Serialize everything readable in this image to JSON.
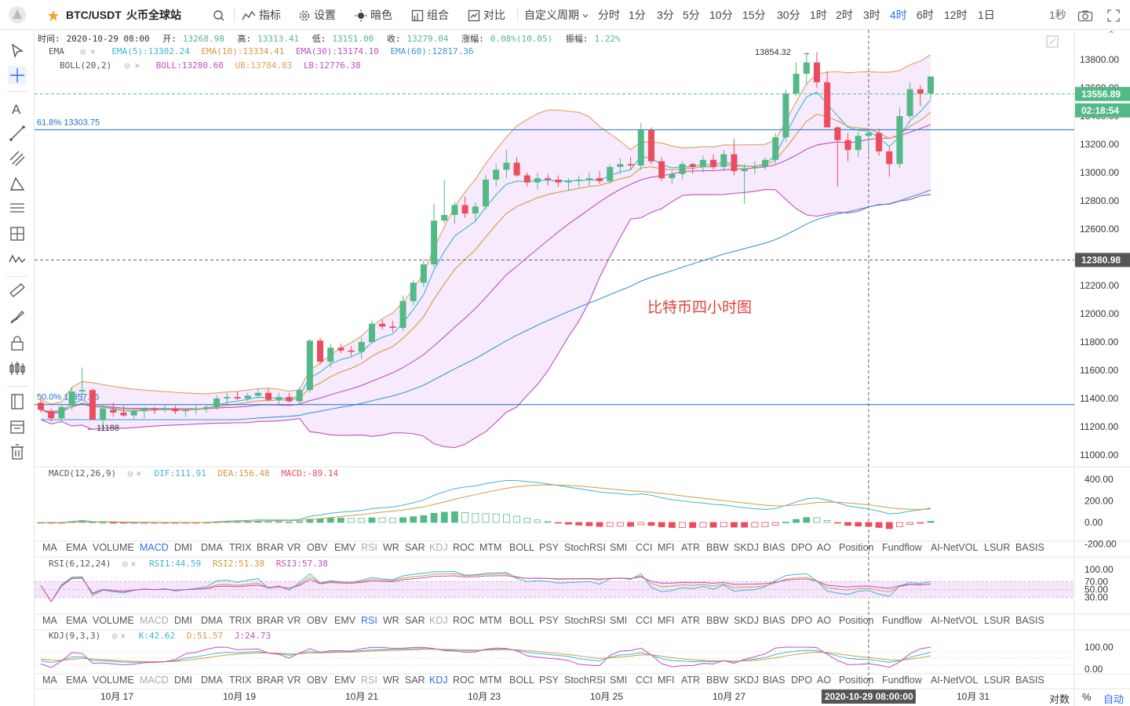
{
  "toolbar": {
    "symbol": "BTC/USDT",
    "exchange": "火币全球站",
    "indicators_label": "指标",
    "settings_label": "设置",
    "theme_label": "暗色",
    "combine_label": "组合",
    "compare_label": "对比",
    "custom_period_label": "自定义周期",
    "intervals": [
      "分时",
      "1分",
      "3分",
      "5分",
      "10分",
      "15分",
      "30分",
      "1时",
      "2时",
      "3时",
      "4时",
      "6时",
      "12时",
      "1日"
    ],
    "active_interval": "4时",
    "refresh_label": "1秒"
  },
  "ohlc_bar": {
    "time_label": "时间:",
    "time": "2020-10-29 08:00",
    "open_label": "开:",
    "open": "13268.98",
    "high_label": "高:",
    "high": "13313.41",
    "low_label": "低:",
    "low": "13151.00",
    "close_label": "收:",
    "close": "13279.04",
    "change_label": "涨幅:",
    "change": "0.08%(10.05)",
    "amplitude_label": "振幅:",
    "amplitude": "1.22%"
  },
  "ema_legend": {
    "name": "EMA",
    "ema5": "EMA(5):13302.24",
    "ema10": "EMA(10):13334.41",
    "ema30": "EMA(30):13174.10",
    "ema60": "EMA(60):12817.36"
  },
  "boll_legend": {
    "name": "BOLL(20,2)",
    "boll": "BOLL:13280.60",
    "ub": "UB:13784.83",
    "lb": "LB:12776.38"
  },
  "macd_legend": {
    "name": "MACD(12,26,9)",
    "dif": "DIF:111.91",
    "dea": "DEA:156.48",
    "macd": "MACD:-89.14"
  },
  "rsi_legend": {
    "name": "RSI(6,12,24)",
    "rsi1": "RSI1:44.59",
    "rsi2": "RSI2:51.38",
    "rsi3": "RSI3:57.38"
  },
  "kdj_legend": {
    "name": "KDJ(9,3,3)",
    "k": "K:42.62",
    "d": "D:51.57",
    "j": "J:24.73"
  },
  "indicator_tabs": [
    "MA",
    "EMA",
    "VOLUME",
    "MACD",
    "DMI",
    "DMA",
    "TRIX",
    "BRAR",
    "VR",
    "OBV",
    "EMV",
    "RSI",
    "WR",
    "SAR",
    "KDJ",
    "ROC",
    "MTM",
    "BOLL",
    "PSY",
    "StochRSI",
    "SMI",
    "CCI",
    "MFI",
    "ATR",
    "BBW",
    "SKDJ",
    "BIAS",
    "DPO",
    "AO",
    "Position",
    "Fundflow",
    "AI-NetVOL",
    "LSUR",
    "BASIS"
  ],
  "annotations": {
    "fib_618": "61.8% 13303.75",
    "fib_500": "50.0% 11357.16",
    "high_marker": "13854.32",
    "low_marker": "11188",
    "watermark": "比特币四小时图"
  },
  "price_labels": {
    "current": "13556.89",
    "countdown": "02:18:54",
    "crosshair": "12380.98"
  },
  "price_axis": [
    "13800.00",
    "13600.00",
    "13400.00",
    "13200.00",
    "13000.00",
    "12800.00",
    "12600.00",
    "12400.00",
    "12200.00",
    "12000.00",
    "11800.00",
    "11600.00",
    "11400.00",
    "11200.00",
    "11000.00"
  ],
  "macd_axis": [
    "400.00",
    "200.00",
    "0.00",
    "-200.00"
  ],
  "rsi_axis": [
    "100.00",
    "70.00",
    "50.00",
    "30.00"
  ],
  "kdj_axis": [
    "100.00",
    "0.00"
  ],
  "time_axis": [
    "10月 17",
    "10月 19",
    "10月 21",
    "10月 23",
    "10月 25",
    "10月 27",
    "10月 31"
  ],
  "time_crosshair": "2020-10-29 08:00:00",
  "footer": {
    "log_label": "对数",
    "percent_label": "%",
    "auto_label": "自动"
  },
  "colors": {
    "up": "#53b987",
    "down": "#eb4d5c",
    "boll_upper": "#e0a060",
    "boll_lower": "#c050c0",
    "boll_fill": "#f5e6fb",
    "ema_short": "#3ab8d0",
    "ema_mid": "#d49a40",
    "ema_long": "#3a9ad0",
    "accent": "#2a6ff0",
    "fib_line": "#1e6fc8"
  },
  "chart_data": {
    "type": "candlestick",
    "interval": "4h",
    "ylim": [
      11000,
      13900
    ],
    "candles_ohlc": [
      [
        11370,
        11420,
        11300,
        11320
      ],
      [
        11310,
        11330,
        11240,
        11260
      ],
      [
        11260,
        11360,
        11230,
        11340
      ],
      [
        11350,
        11480,
        11320,
        11450
      ],
      [
        11450,
        11620,
        11410,
        11460
      ],
      [
        11460,
        11470,
        11250,
        11250
      ],
      [
        11250,
        11360,
        11170,
        11330
      ],
      [
        11320,
        11370,
        11270,
        11300
      ],
      [
        11300,
        11350,
        11270,
        11280
      ],
      [
        11280,
        11320,
        11250,
        11310
      ],
      [
        11310,
        11340,
        11260,
        11330
      ],
      [
        11330,
        11340,
        11290,
        11320
      ],
      [
        11320,
        11360,
        11300,
        11330
      ],
      [
        11330,
        11350,
        11290,
        11310
      ],
      [
        11310,
        11330,
        11270,
        11320
      ],
      [
        11320,
        11350,
        11290,
        11330
      ],
      [
        11330,
        11360,
        11300,
        11340
      ],
      [
        11340,
        11420,
        11320,
        11400
      ],
      [
        11400,
        11440,
        11360,
        11410
      ],
      [
        11410,
        11450,
        11390,
        11400
      ],
      [
        11400,
        11440,
        11380,
        11420
      ],
      [
        11420,
        11470,
        11400,
        11440
      ],
      [
        11440,
        11470,
        11380,
        11390
      ],
      [
        11390,
        11440,
        11360,
        11410
      ],
      [
        11410,
        11440,
        11370,
        11380
      ],
      [
        11380,
        11480,
        11360,
        11460
      ],
      [
        11460,
        11820,
        11440,
        11810
      ],
      [
        11810,
        11830,
        11640,
        11660
      ],
      [
        11660,
        11790,
        11620,
        11760
      ],
      [
        11760,
        11790,
        11720,
        11740
      ],
      [
        11740,
        11770,
        11700,
        11730
      ],
      [
        11730,
        11830,
        11680,
        11800
      ],
      [
        11800,
        11950,
        11790,
        11930
      ],
      [
        11930,
        11960,
        11890,
        11910
      ],
      [
        11910,
        11950,
        11870,
        11900
      ],
      [
        11900,
        12130,
        11880,
        12090
      ],
      [
        12090,
        12240,
        12060,
        12220
      ],
      [
        12220,
        12380,
        12190,
        12350
      ],
      [
        12350,
        12780,
        12330,
        12660
      ],
      [
        12660,
        12950,
        12640,
        12700
      ],
      [
        12700,
        12790,
        12640,
        12770
      ],
      [
        12770,
        12830,
        12680,
        12710
      ],
      [
        12710,
        12790,
        12660,
        12760
      ],
      [
        12760,
        12980,
        12740,
        12950
      ],
      [
        12950,
        13060,
        12900,
        13020
      ],
      [
        13020,
        13160,
        12960,
        13070
      ],
      [
        13070,
        13110,
        12970,
        12980
      ],
      [
        12980,
        13000,
        12900,
        12930
      ],
      [
        12930,
        13000,
        12880,
        12960
      ],
      [
        12960,
        12990,
        12910,
        12950
      ],
      [
        12950,
        12980,
        12900,
        12930
      ],
      [
        12930,
        12960,
        12870,
        12940
      ],
      [
        12940,
        12980,
        12900,
        12950
      ],
      [
        12950,
        13000,
        12900,
        12960
      ],
      [
        12960,
        13010,
        12920,
        12940
      ],
      [
        12940,
        13060,
        12920,
        13040
      ],
      [
        13040,
        13100,
        12990,
        13060
      ],
      [
        13060,
        13110,
        13020,
        13050
      ],
      [
        13050,
        13350,
        13020,
        13300
      ],
      [
        13300,
        13320,
        13060,
        13080
      ],
      [
        13080,
        13110,
        12940,
        12960
      ],
      [
        12960,
        13010,
        12920,
        12990
      ],
      [
        12990,
        13080,
        12950,
        13060
      ],
      [
        13060,
        13070,
        12990,
        13040
      ],
      [
        13040,
        13120,
        13000,
        13090
      ],
      [
        13090,
        13130,
        13020,
        13040
      ],
      [
        13040,
        13160,
        13010,
        13130
      ],
      [
        13130,
        13240,
        12980,
        13010
      ],
      [
        13010,
        13060,
        12780,
        13030
      ],
      [
        13030,
        13080,
        12990,
        13040
      ],
      [
        13040,
        13110,
        13020,
        13090
      ],
      [
        13090,
        13280,
        13060,
        13250
      ],
      [
        13250,
        13590,
        13220,
        13560
      ],
      [
        13560,
        13780,
        13540,
        13700
      ],
      [
        13700,
        13840,
        13620,
        13780
      ],
      [
        13780,
        13854,
        13600,
        13640
      ],
      [
        13640,
        13720,
        13330,
        13320
      ],
      [
        13320,
        13330,
        12900,
        13230
      ],
      [
        13230,
        13280,
        13080,
        13160
      ],
      [
        13160,
        13290,
        13110,
        13260
      ],
      [
        13260,
        13310,
        13120,
        13280
      ],
      [
        13280,
        13310,
        13120,
        13150
      ],
      [
        13150,
        13180,
        12970,
        13060
      ],
      [
        13060,
        13460,
        13030,
        13400
      ],
      [
        13400,
        13640,
        13380,
        13590
      ],
      [
        13590,
        13620,
        13470,
        13560
      ],
      [
        13560,
        13680,
        13520,
        13680
      ]
    ]
  }
}
